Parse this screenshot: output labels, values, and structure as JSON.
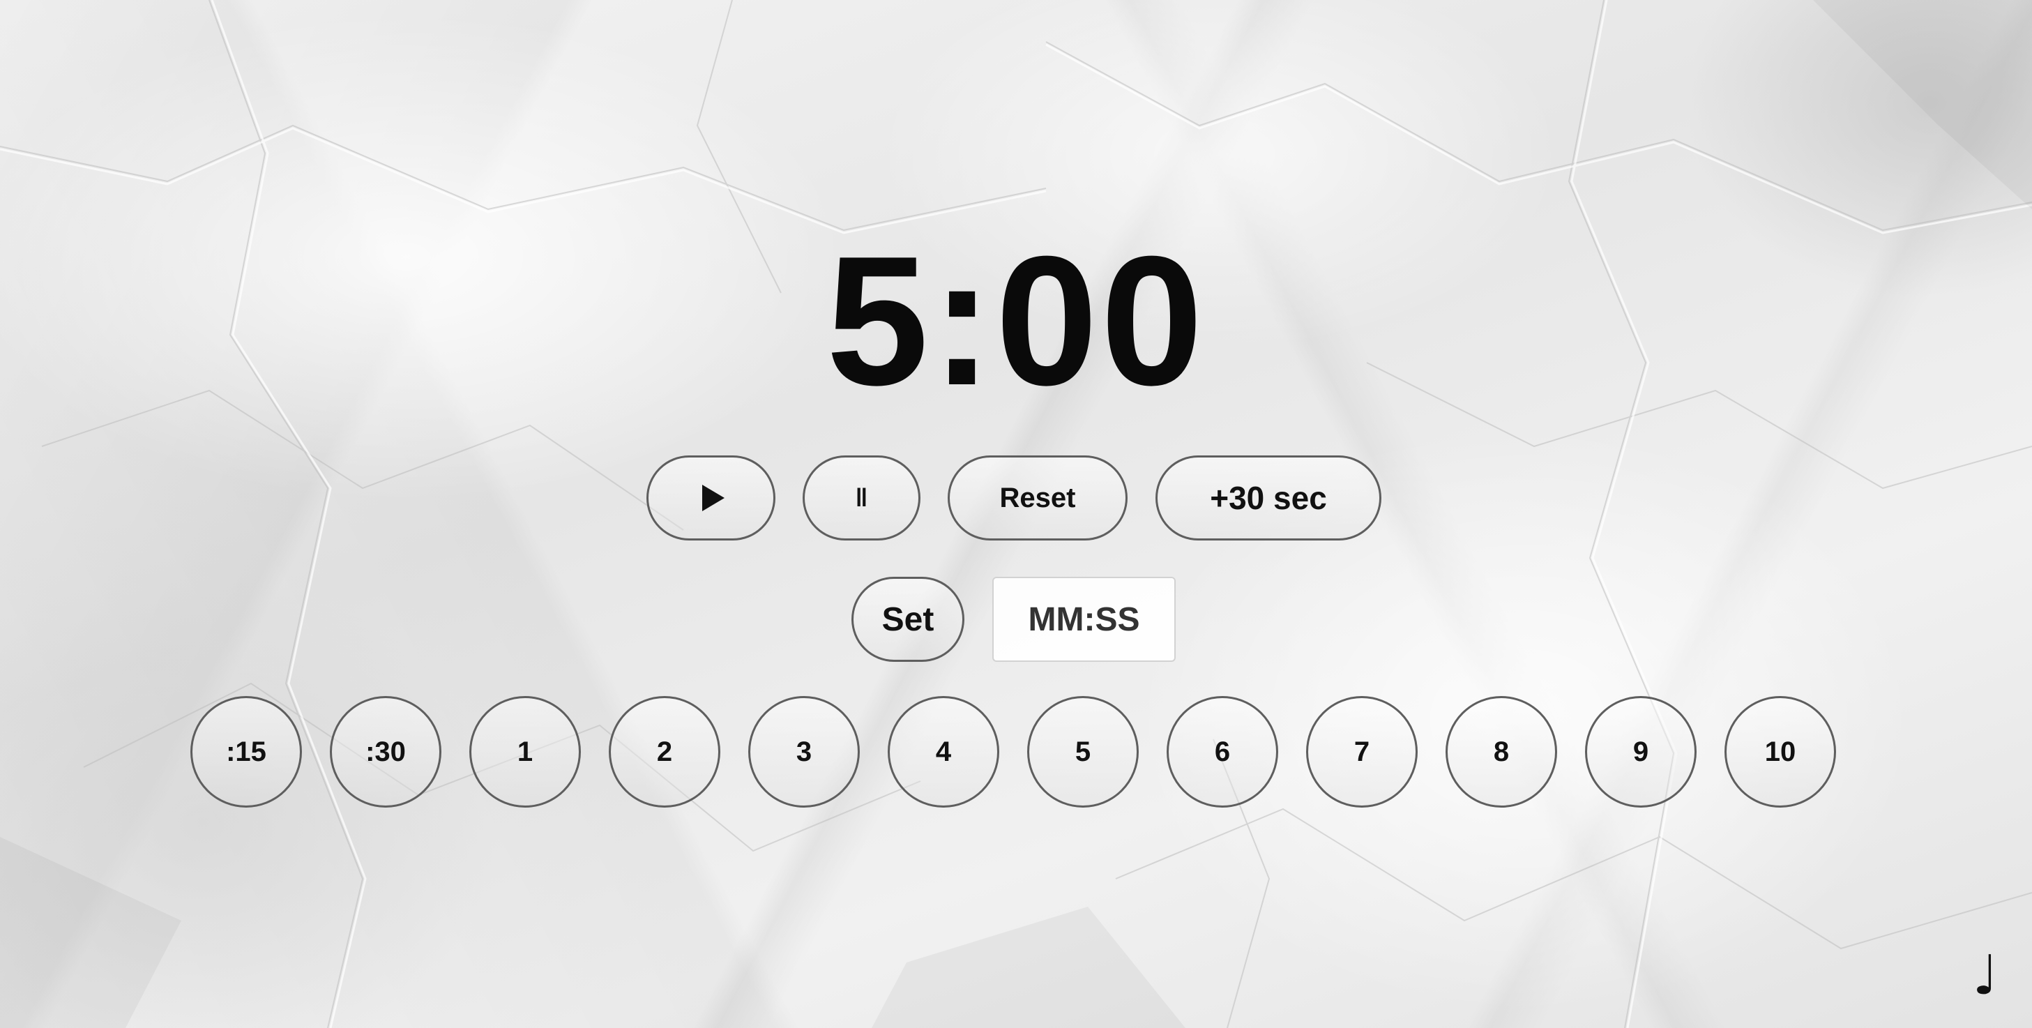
{
  "timer": {
    "display": "5:00"
  },
  "controls": {
    "play_icon": "play-icon",
    "pause_label": "‖",
    "reset_label": "Reset",
    "add30_label": "+30 sec"
  },
  "custom_time": {
    "set_label": "Set",
    "placeholder": "MM:SS",
    "value": ""
  },
  "presets": [
    ":15",
    ":30",
    "1",
    "2",
    "3",
    "4",
    "5",
    "6",
    "7",
    "8",
    "9",
    "10"
  ],
  "music_toggle": {
    "icon": "music-note-icon",
    "glyph": "♩"
  },
  "theme": {
    "background": "crumpled-white-paper",
    "text_color": "#111111",
    "border_color": "#5e5e5e"
  }
}
